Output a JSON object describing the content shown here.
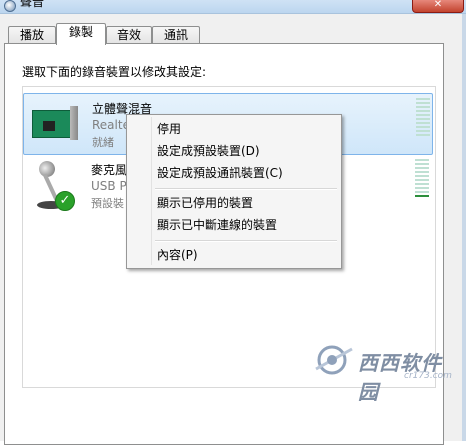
{
  "window": {
    "title": "聲音",
    "close_label": "✕"
  },
  "tabs": [
    {
      "label": "播放",
      "active": false
    },
    {
      "label": "錄製",
      "active": true
    },
    {
      "label": "音效",
      "active": false
    },
    {
      "label": "通訊",
      "active": false
    }
  ],
  "instruction": "選取下面的錄音裝置以修改其設定:",
  "devices": [
    {
      "name": "立體聲混音",
      "sub": "Realte",
      "status": "就緒",
      "icon": "sound-card-icon",
      "selected": true
    },
    {
      "name": "麥克風",
      "sub": "USB Pr",
      "status": "預設裝",
      "icon": "microphone-icon",
      "default": true
    }
  ],
  "context_menu": {
    "items": [
      "停用",
      "設定成預設裝置(D)",
      "設定成預設通訊裝置(C)",
      "顯示已停用的裝置",
      "顯示已中斷連線的裝置",
      "內容(P)"
    ]
  },
  "watermark": {
    "text": "西西软件园",
    "url": "cr173.com"
  }
}
